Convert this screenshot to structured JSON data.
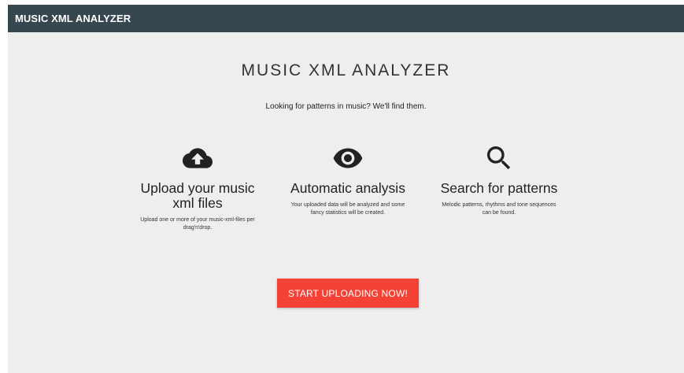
{
  "header": {
    "brand": "MUSIC XML ANALYZER"
  },
  "hero": {
    "title": "MUSIC XML ANALYZER",
    "tagline": "Looking for patterns in music? We'll find them."
  },
  "features": [
    {
      "icon": "cloud-upload-icon",
      "title": "Upload your music xml files",
      "description": "Upload one or more of your music-xml-files per drag'n'drop."
    },
    {
      "icon": "eye-icon",
      "title": "Automatic analysis",
      "description": "Your uploaded data will be analyzed and some fancy statistics will be created."
    },
    {
      "icon": "search-icon",
      "title": "Search for patterns",
      "description": "Melodic patterns, rhythms and tone sequences can be found."
    }
  ],
  "cta": {
    "label": "START UPLOADING NOW!"
  },
  "colors": {
    "header_bg": "#37474f",
    "page_bg": "#eeeeee",
    "accent": "#f44336"
  }
}
